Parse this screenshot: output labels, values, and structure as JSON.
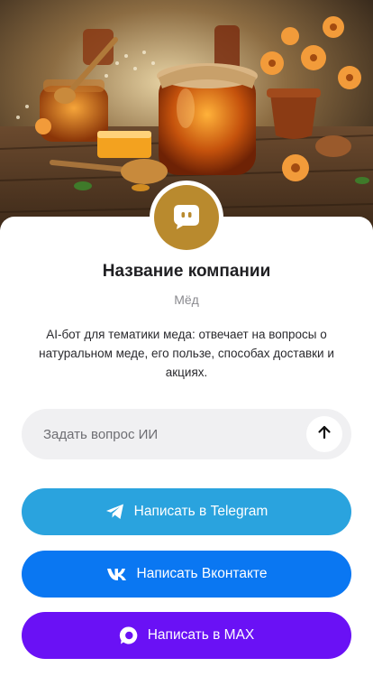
{
  "company": {
    "name": "Название компании",
    "category": "Мёд",
    "description": "AI-бот для тематики меда: отвечает на вопросы о натуральном меде, его пользе, способах доставки и акциях.",
    "avatar_icon": "chat-bubble-icon",
    "avatar_color": "#b98a2e"
  },
  "ask": {
    "placeholder": "Задать вопрос ИИ",
    "value": "",
    "send_icon": "arrow-up-icon"
  },
  "buttons": {
    "telegram": {
      "label": "Написать в Telegram",
      "icon": "telegram-icon",
      "color": "#2aa3de"
    },
    "vk": {
      "label": "Написать Вконтакте",
      "icon": "vk-icon",
      "color": "#0a77f2"
    },
    "max": {
      "label": "Написать в MAX",
      "icon": "max-icon",
      "color": "#6a11f5"
    }
  }
}
